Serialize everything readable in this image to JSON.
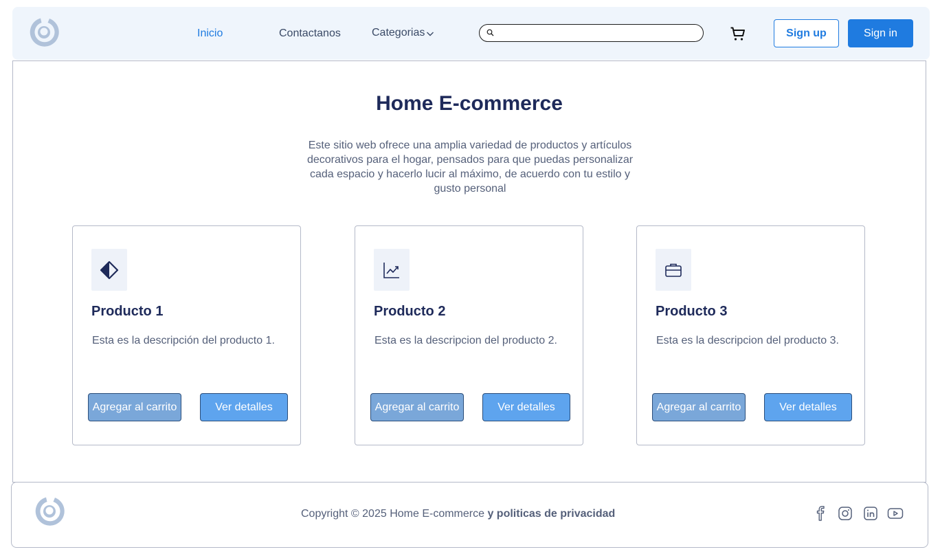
{
  "nav": {
    "links": [
      "Inicio",
      "Contactanos",
      "Categorias"
    ],
    "search_placeholder": "",
    "signup_label": "Sign up",
    "signin_label": "Sign in"
  },
  "hero": {
    "title": "Home E-commerce",
    "description": "Este sitio web ofrece una amplia variedad de productos y artículos decorativos para el hogar, pensados para que puedas personalizar cada espacio y hacerlo lucir al máximo, de acuerdo con tu estilo y gusto personal"
  },
  "products": [
    {
      "title": "Producto 1",
      "description": "Esta es la descripción del producto 1.",
      "icon": "contrast-icon",
      "add_label": "Agregar al carrito",
      "details_label": "Ver detalles"
    },
    {
      "title": "Producto 2",
      "description": "Esta es la descripcion del producto 2.",
      "icon": "chart-line-icon",
      "add_label": "Agregar al carrito",
      "details_label": "Ver detalles"
    },
    {
      "title": "Producto 3",
      "description": "Esta es la descripcion del producto 3.",
      "icon": "briefcase-icon",
      "add_label": "Agregar al carrito",
      "details_label": "Ver detalles"
    }
  ],
  "footer": {
    "copyright": "Copyright © 2025 Home E-commerce",
    "policy": "y politicas de privacidad",
    "social": [
      "facebook-icon",
      "instagram-icon",
      "linkedin-icon",
      "youtube-icon"
    ]
  },
  "colors": {
    "primary": "#1f7be0",
    "nav_bg": "#eff5fc",
    "heading": "#1e2a5a",
    "body_text": "#55607a",
    "add_button": "#7aa7d9",
    "details_button": "#5ea4ee"
  }
}
